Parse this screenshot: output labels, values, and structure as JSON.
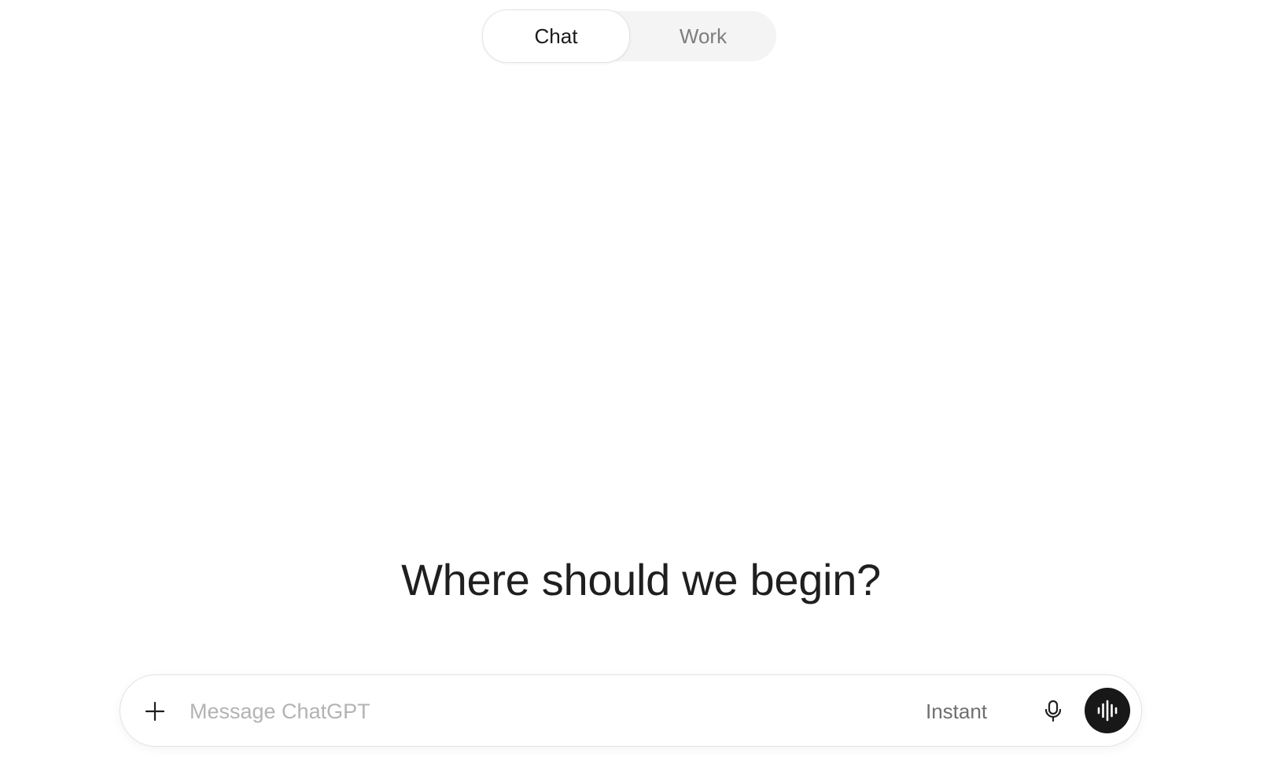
{
  "mode_toggle": {
    "tabs": [
      {
        "label": "Chat",
        "active": true
      },
      {
        "label": "Work",
        "active": false
      }
    ]
  },
  "heading": "Where should we begin?",
  "composer": {
    "placeholder": "Message ChatGPT",
    "value": "",
    "model_label": "Instant",
    "icons": {
      "add": "plus-icon",
      "mic": "microphone-icon",
      "voice": "voice-waveform-icon"
    }
  },
  "colors": {
    "background": "#ffffff",
    "toggle_background": "#f4f4f4",
    "active_tab_text": "#1a1a1a",
    "inactive_tab_text": "#7d7d7d",
    "heading_text": "#1f1f1f",
    "placeholder_text": "#b3b3b3",
    "voice_button": "#181818"
  }
}
